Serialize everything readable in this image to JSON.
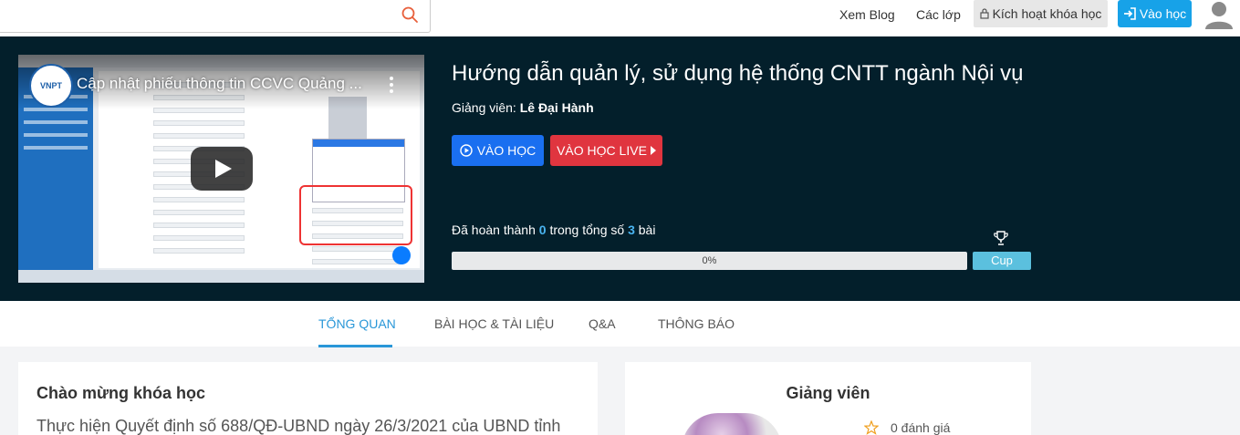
{
  "header": {
    "search": {
      "placeholder": "",
      "value": ""
    },
    "nav": {
      "blog": "Xem Blog",
      "classes": "Các lớp"
    },
    "activate_label": "Kích hoạt khóa học",
    "login_label": "Vào học"
  },
  "video": {
    "title": "Cập nhật phiếu thông tin CCVC Quảng ...",
    "logo_text": "VNPT"
  },
  "course": {
    "title": "Hướng dẫn quản lý, sử dụng hệ thống CNTT ngành Nội vụ",
    "teacher_label": "Giảng viên:",
    "teacher_name": "Lê Đại Hành",
    "start_button": "VÀO HỌC",
    "live_button": "VÀO HỌC LIVE",
    "progress": {
      "prefix": "Đã hoàn thành",
      "completed": "0",
      "middle": "trong tổng số",
      "total": "3",
      "suffix": "bài",
      "percent_label": "0%",
      "percent_value": 0
    },
    "cup_button": "Cup"
  },
  "tabs": [
    {
      "label": "TỔNG QUAN",
      "active": true
    },
    {
      "label": "BÀI HỌC & TÀI LIỆU",
      "active": false
    },
    {
      "label": "Q&A",
      "active": false
    },
    {
      "label": "THÔNG BÁO",
      "active": false
    }
  ],
  "welcome": {
    "heading": "Chào mừng khóa học",
    "text": "Thực hiện Quyết định số 688/QĐ-UBND ngày 26/3/2021 của UBND tỉnh"
  },
  "instructor_card": {
    "heading": "Giảng viên",
    "rating_text": "0 đánh giá"
  },
  "colors": {
    "hero_bg": "#031f2b",
    "primary": "#1a6ff0",
    "live": "#e0353f",
    "accent": "#2997d8",
    "cup": "#5bc0de"
  },
  "icons": [
    "search-icon",
    "lock-icon",
    "login-icon",
    "user-avatar-icon",
    "play-circle-icon",
    "caret-right-icon",
    "trophy-icon",
    "star-icon",
    "play-icon",
    "more-vert-icon"
  ]
}
